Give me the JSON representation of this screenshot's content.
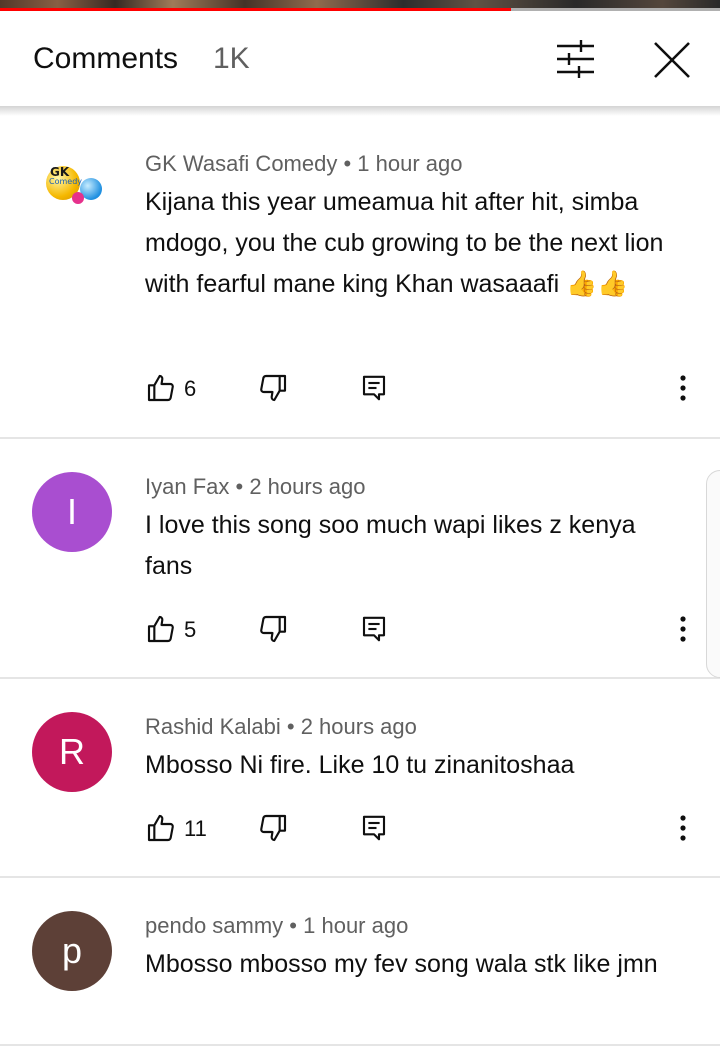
{
  "header": {
    "title": "Comments",
    "count": "1K",
    "filter_icon": "tune-filter-icon",
    "close_icon": "close-icon"
  },
  "player": {
    "progress_percent": 71,
    "progress_color": "#ff0000"
  },
  "comments": [
    {
      "author": "GK Wasafi Comedy",
      "time": "1 hour ago",
      "avatar_text": "GK",
      "avatar_subtext": "Comedy",
      "text": "Kijana this year umeamua hit after hit, simba mdogo, you the cub growing to be the next lion with fearful mane king Khan wasaaafi 👍👍",
      "likes": "6"
    },
    {
      "author": "Iyan Fax",
      "time": "2 hours ago",
      "avatar_letter": "I",
      "avatar_color": "#a94ed0",
      "text": "I love this song soo much wapi likes z kenya fans",
      "likes": "5"
    },
    {
      "author": "Rashid Kalabi",
      "time": "2 hours ago",
      "avatar_letter": "R",
      "avatar_color": "#c2185b",
      "text": "Mbosso Ni fire. Like 10 tu zinanitoshaa",
      "likes": "11"
    },
    {
      "author": "pendo sammy",
      "time": "1 hour ago",
      "avatar_letter": "p",
      "avatar_color": "#5d4037",
      "text": "Mbosso mbosso my fev song wala stk like jmn"
    }
  ]
}
